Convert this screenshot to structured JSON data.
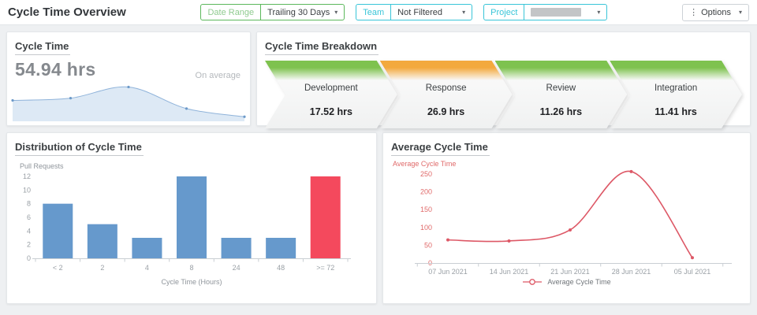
{
  "header": {
    "title": "Cycle Time Overview",
    "filters": {
      "date_range_label": "Date Range",
      "date_range_value": "Trailing 30 Days",
      "team_label": "Team",
      "team_value": "Not Filtered",
      "project_label": "Project"
    },
    "options_label": "Options"
  },
  "cycle_time": {
    "title": "Cycle Time",
    "value": "54.94 hrs",
    "caption": "On average"
  },
  "breakdown": {
    "title": "Cycle Time Breakdown",
    "stages": [
      {
        "name": "Development",
        "value": "17.52 hrs",
        "color": "green"
      },
      {
        "name": "Response",
        "value": "26.9 hrs",
        "color": "orange"
      },
      {
        "name": "Review",
        "value": "11.26 hrs",
        "color": "green"
      },
      {
        "name": "Integration",
        "value": "11.41 hrs",
        "color": "green"
      }
    ]
  },
  "distribution": {
    "title": "Distribution of Cycle Time"
  },
  "average": {
    "title": "Average Cycle Time"
  },
  "colors": {
    "green_accent": "#5cb85c",
    "teal_accent": "#39c5d8",
    "stage_green": "#7ec24f",
    "stage_orange": "#f3a93e",
    "spark_fill": "#dde9f5",
    "spark_line": "#8fb3da",
    "spark_dot": "#6d9ac9",
    "bar_blue": "#6699cc",
    "bar_red": "#f4495d",
    "line_red": "#dd5866",
    "axis_text": "#9aa0a6",
    "axis_line": "#c9ced3",
    "red_tick_text": "#e06a6a"
  },
  "chart_data": [
    {
      "id": "spark",
      "type": "area",
      "title": "Cycle Time trend sparkline",
      "x": [
        0,
        1,
        2,
        3,
        4
      ],
      "values": [
        27,
        30,
        45,
        16,
        5
      ],
      "ylim": [
        0,
        55
      ],
      "grid": false,
      "legend_position": "none"
    },
    {
      "id": "distribution",
      "type": "bar",
      "title": "Distribution of Cycle Time",
      "categories": [
        "< 2",
        "2",
        "4",
        "8",
        "24",
        "48",
        ">= 72"
      ],
      "values": [
        8,
        5,
        3,
        12,
        3,
        3,
        12
      ],
      "bar_colors": [
        "#6699cc",
        "#6699cc",
        "#6699cc",
        "#6699cc",
        "#6699cc",
        "#6699cc",
        "#f4495d"
      ],
      "xlabel": "Cycle Time (Hours)",
      "ylabel": "Pull Requests",
      "ylim": [
        0,
        12
      ],
      "yticks": [
        0,
        2,
        4,
        6,
        8,
        10,
        12
      ],
      "grid": false
    },
    {
      "id": "average",
      "type": "line",
      "title": "Average Cycle Time",
      "categories": [
        "07 Jun 2021",
        "14 Jun 2021",
        "21 Jun 2021",
        "28 Jun 2021",
        "05 Jul 2021"
      ],
      "values": [
        65,
        62,
        93,
        257,
        15
      ],
      "ylabel": "Average Cycle Time",
      "ylim": [
        0,
        275
      ],
      "yticks": [
        0,
        50,
        100,
        150,
        200,
        250
      ],
      "legend": "Average Cycle Time",
      "legend_position": "bottom",
      "grid": false
    }
  ]
}
